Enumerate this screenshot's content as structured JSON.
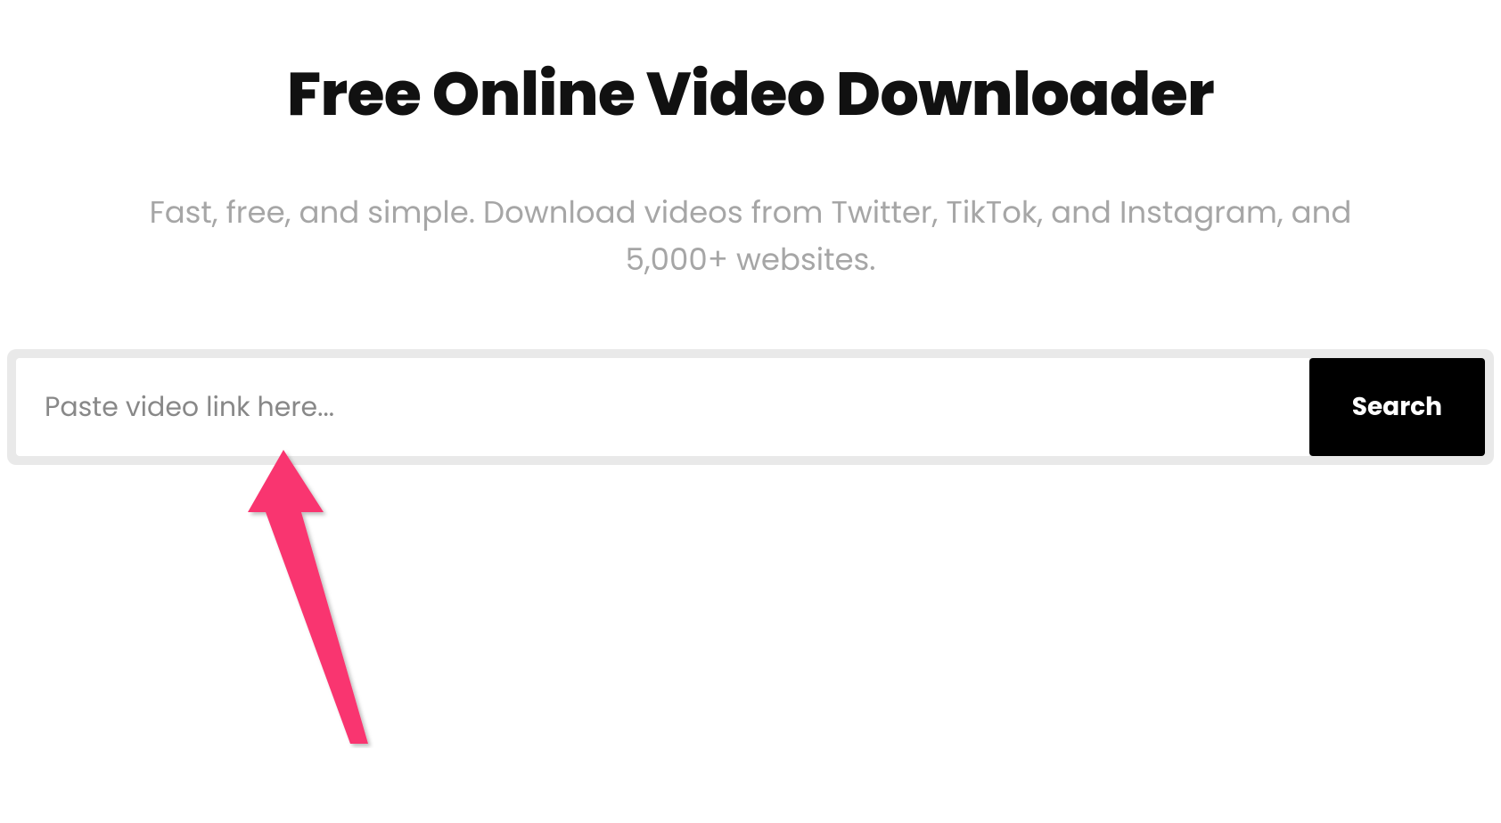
{
  "hero": {
    "title": "Free Online Video Downloader",
    "subtitle": "Fast, free, and simple. Download videos from Twitter, TikTok, and Instagram, and 5,000+ websites."
  },
  "search": {
    "placeholder": "Paste video link here...",
    "value": "",
    "button_label": "Search"
  },
  "annotation": {
    "arrow_color": "#f9356f"
  }
}
